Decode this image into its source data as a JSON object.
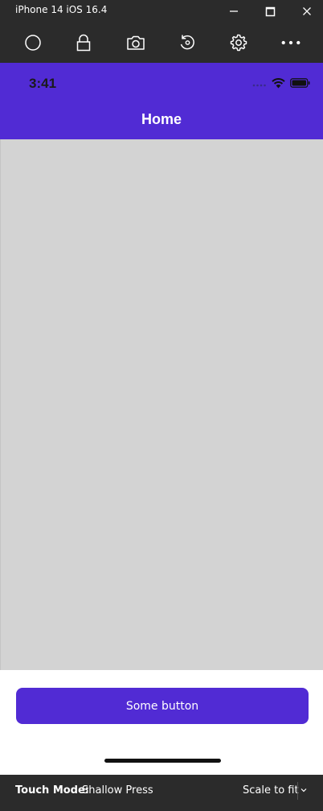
{
  "window": {
    "title": "iPhone 14 iOS 16.4",
    "controls": [
      "minimize-icon",
      "maximize-icon",
      "close-icon"
    ]
  },
  "toolbar": {
    "tools": [
      {
        "name": "home-button",
        "icon": "circle-icon"
      },
      {
        "name": "lock-button",
        "icon": "lock-icon"
      },
      {
        "name": "screenshot-button",
        "icon": "camera-icon"
      },
      {
        "name": "rotate-button",
        "icon": "rotate-icon"
      },
      {
        "name": "settings-button",
        "icon": "gear-icon"
      },
      {
        "name": "more-button",
        "icon": "more-icon"
      }
    ]
  },
  "phone": {
    "status_time": "3:41",
    "status_icons": [
      "signal-dots-icon",
      "wifi-icon",
      "battery-icon"
    ],
    "nav_title": "Home",
    "button_label": "Some button",
    "colors": {
      "accent": "#512bd4",
      "content_background": "#d3d3d3"
    }
  },
  "footer": {
    "touch_mode_label": "Touch Mode:",
    "touch_mode_value": "Shallow Press",
    "scale_value": "Scale to fit"
  }
}
